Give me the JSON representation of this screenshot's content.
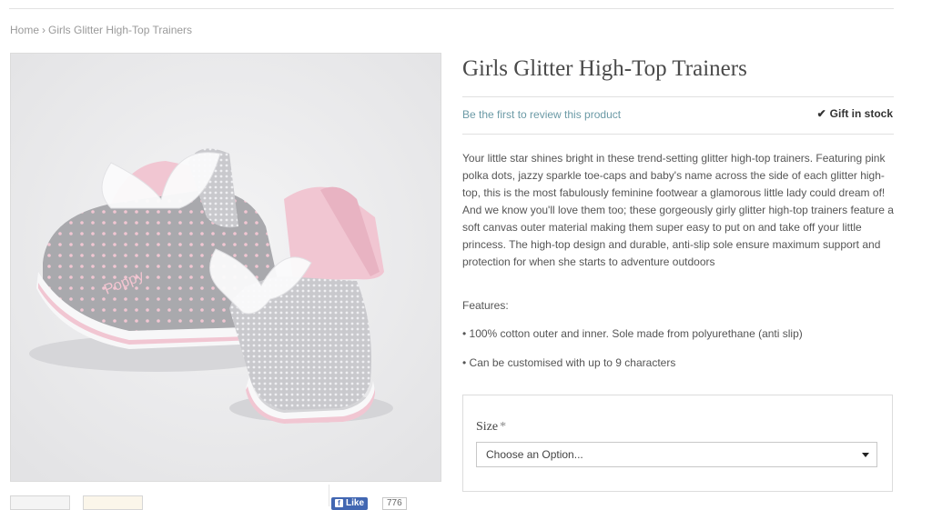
{
  "breadcrumb": {
    "home": "Home",
    "separator": "›",
    "current": "Girls Glitter High-Top Trainers"
  },
  "product": {
    "title": "Girls Glitter High-Top Trainers",
    "review_link": "Be the first to review this product",
    "stock_icon": "✔",
    "stock": "Gift in stock",
    "description": "Your little star shines bright in these trend-setting glitter high-top trainers. Featuring pink polka dots, jazzy sparkle toe-caps and baby's name across the side of each glitter high-top, this is the most fabulously feminine footwear a glamorous little lady could dream of! And we know you'll love them too; these gorgeously girly glitter high-top trainers feature a soft canvas outer material making them super easy to put on and take off your little princess. The high-top design and durable, anti-slip sole ensure maximum support and protection for when she starts to adventure outdoors",
    "features_label": "Features:",
    "features": [
      "• 100% cotton outer and inner. Sole made from polyurethane (anti slip)",
      "• Can be customised with up to 9 characters"
    ],
    "shoe_name_print": "Poppy"
  },
  "options": {
    "size_label": "Size",
    "required_marker": "*",
    "size_select_value": "Choose an Option..."
  },
  "social": {
    "like_label": "Like",
    "like_icon": "f",
    "like_count": "776"
  },
  "colors": {
    "link": "#6b9aa6",
    "facebook": "#4267b2",
    "shoe_pink": "#f1c6d2",
    "shoe_grey": "#a9a9ad"
  }
}
